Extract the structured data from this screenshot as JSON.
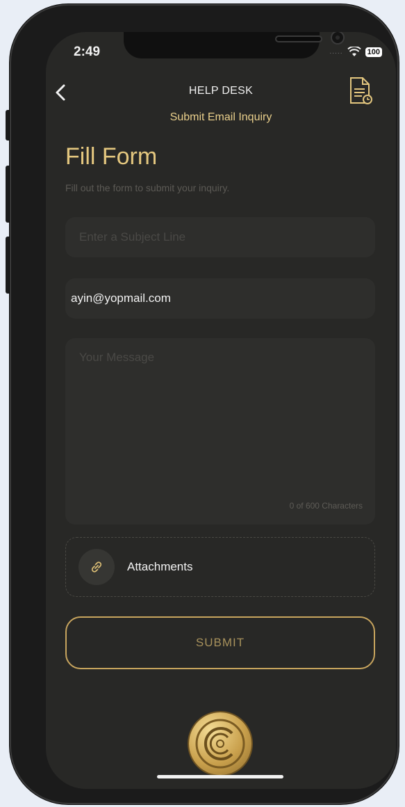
{
  "status_bar": {
    "time": "2:49",
    "signal_dots": ".....",
    "battery": "100"
  },
  "header": {
    "title": "HELP DESK",
    "subtitle": "Submit Email Inquiry",
    "back_glyph": "<"
  },
  "form": {
    "title": "Fill Form",
    "description": "Fill out the form to submit your inquiry.",
    "subject_placeholder": "Enter a Subject Line",
    "subject_value": "",
    "email_value": "ayin@yopmail.com",
    "message_placeholder": "Your Message",
    "message_value": "",
    "char_counter": "0 of 600 Characters"
  },
  "attachments": {
    "label": "Attachments",
    "icon": "link-icon"
  },
  "submit": {
    "label": "SUBMIT"
  },
  "icons": {
    "back": "chevron-left-icon",
    "history": "document-clock-icon",
    "logo": "brand-logo"
  },
  "colors": {
    "accent_gold": "#e4c77f",
    "button_border": "#c8a55e",
    "background": "#282826",
    "field": "#2e2e2c"
  }
}
